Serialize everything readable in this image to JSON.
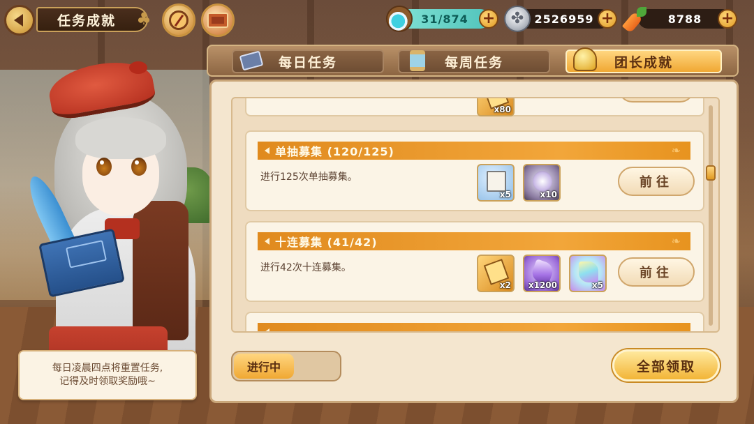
{
  "header": {
    "title": "任务成就",
    "back_icon": "back-arrow-icon",
    "resources": {
      "stamina": "31/874",
      "coins": "2526959",
      "carrots": "8788"
    }
  },
  "tabs": [
    {
      "label": "每日任务",
      "icon": "quill-book-icon",
      "selected": false
    },
    {
      "label": "每周任务",
      "icon": "hourglass-icon",
      "selected": false
    },
    {
      "label": "团长成就",
      "icon": "trophy-icon",
      "selected": true
    }
  ],
  "tasks": [
    {
      "title": "",
      "description": "",
      "rewards": [
        {
          "icon": "gold-card-icon",
          "count": "x80"
        }
      ],
      "button_label": ""
    },
    {
      "title": "单抽募集 (120/125)",
      "description": "进行125次单抽募集。",
      "rewards": [
        {
          "icon": "notebook-icon",
          "count": "x5"
        },
        {
          "icon": "orb-fragment-icon",
          "count": "x10"
        }
      ],
      "button_label": "前往"
    },
    {
      "title": "十连募集 (41/42)",
      "description": "进行42次十连募集。",
      "rewards": [
        {
          "icon": "gold-card-icon",
          "count": "x2"
        },
        {
          "icon": "purple-crystal-icon",
          "count": "x1200"
        },
        {
          "icon": "prism-crystal-icon",
          "count": "x5"
        }
      ],
      "button_label": "前往"
    },
    {
      "title": "",
      "description": "",
      "rewards": [],
      "button_label": ""
    }
  ],
  "footer": {
    "status_label": "进行中",
    "claim_all_label": "全部领取"
  },
  "tip": {
    "line1": "每日凌晨四点将重置任务,",
    "line2": "记得及时领取奖励哦~"
  },
  "colors": {
    "accent_gold": "#f0a833",
    "header_orange": "#e08a1e",
    "panel_bg": "#f4e6cf",
    "stamina_teal": "#52c4bc"
  }
}
